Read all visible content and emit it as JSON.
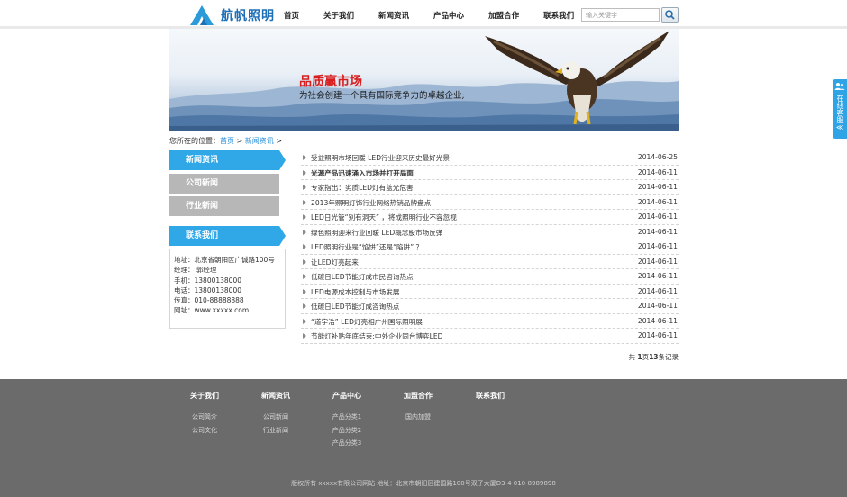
{
  "header": {
    "logo_text": "航帆照明",
    "nav": [
      "首页",
      "关于我们",
      "新闻资讯",
      "产品中心",
      "加盟合作",
      "联系我们"
    ],
    "search_placeholder": "输入关键字"
  },
  "banner": {
    "title": "品质赢市场",
    "subtitle": "为社会创建一个具有国际竞争力的卓越企业;"
  },
  "breadcrumb": {
    "prefix": "您所在的位置：",
    "home": "首页",
    "sep": ">",
    "current": "新闻资讯"
  },
  "sidebar": {
    "section_title": "新闻资讯",
    "items": [
      "公司新闻",
      "行业新闻"
    ],
    "contact_title": "联系我们",
    "contact_lines": [
      "地址：北京省朝阳区广诚路100号",
      "经理： 郭经理",
      "手机：13800138000",
      "电话：13800138000",
      "传真：010-88888888",
      "网址：www.xxxxx.com"
    ]
  },
  "news": [
    {
      "title": "受益照明市场回暖 LED行业迎来历史最好光景",
      "date": "2014-06-25",
      "bold": false
    },
    {
      "title": "光源产品迅速涌入市场并打开局面",
      "date": "2014-06-11",
      "bold": true
    },
    {
      "title": "专家指出：劣质LED灯有蓝光危害",
      "date": "2014-06-11",
      "bold": false
    },
    {
      "title": "2013年照明灯饰行业网络热销品牌盘点",
      "date": "2014-06-11",
      "bold": false
    },
    {
      "title": "LED日光管“别有洞天” ，将成照明行业不容忽视",
      "date": "2014-06-11",
      "bold": false
    },
    {
      "title": "绿色照明迎来行业回暖 LED概念股市场反弹",
      "date": "2014-06-11",
      "bold": false
    },
    {
      "title": "LED照明行业是“馅饼”还是“陷阱” ？",
      "date": "2014-06-11",
      "bold": false
    },
    {
      "title": "让LED灯亮起来",
      "date": "2014-06-11",
      "bold": false
    },
    {
      "title": "低碳日LED节能灯成市民咨询热点",
      "date": "2014-06-11",
      "bold": false
    },
    {
      "title": "LED电源成本控制与市场发展",
      "date": "2014-06-11",
      "bold": false
    },
    {
      "title": "低碳日LED节能灯成咨询热点",
      "date": "2014-06-11",
      "bold": false
    },
    {
      "title": "“道宇浩” LED灯亮相广州国际照明展",
      "date": "2014-06-11",
      "bold": false
    },
    {
      "title": "节能灯补贴年底结束:中外企业同台博弈LED",
      "date": "2014-06-11",
      "bold": false
    }
  ],
  "pager": {
    "prefix": "共 ",
    "pages": "1",
    "mid": "页",
    "count": "13",
    "suffix": "条记录"
  },
  "footer": {
    "columns": [
      {
        "title": "关于我们",
        "links": [
          "公司简介",
          "公司文化"
        ]
      },
      {
        "title": "新闻资讯",
        "links": [
          "公司新闻",
          "行业新闻"
        ]
      },
      {
        "title": "产品中心",
        "links": [
          "产品分类1",
          "产品分类2",
          "产品分类3"
        ]
      },
      {
        "title": "加盟合作",
        "links": [
          "国内加盟"
        ]
      },
      {
        "title": "联系我们",
        "links": []
      }
    ],
    "copyright": "版权所有 xxxxx有限公司网站 地址：北京市朝阳区建国路100号双子大厦D3-4 010-8989898"
  },
  "float_service": {
    "label": "在线客服",
    "chevron": "≪"
  },
  "colors": {
    "accent": "#30a8e8",
    "side_gray": "#b7b7b7",
    "footer_bg": "#6b6b6b",
    "banner_red": "#d81e1e"
  }
}
